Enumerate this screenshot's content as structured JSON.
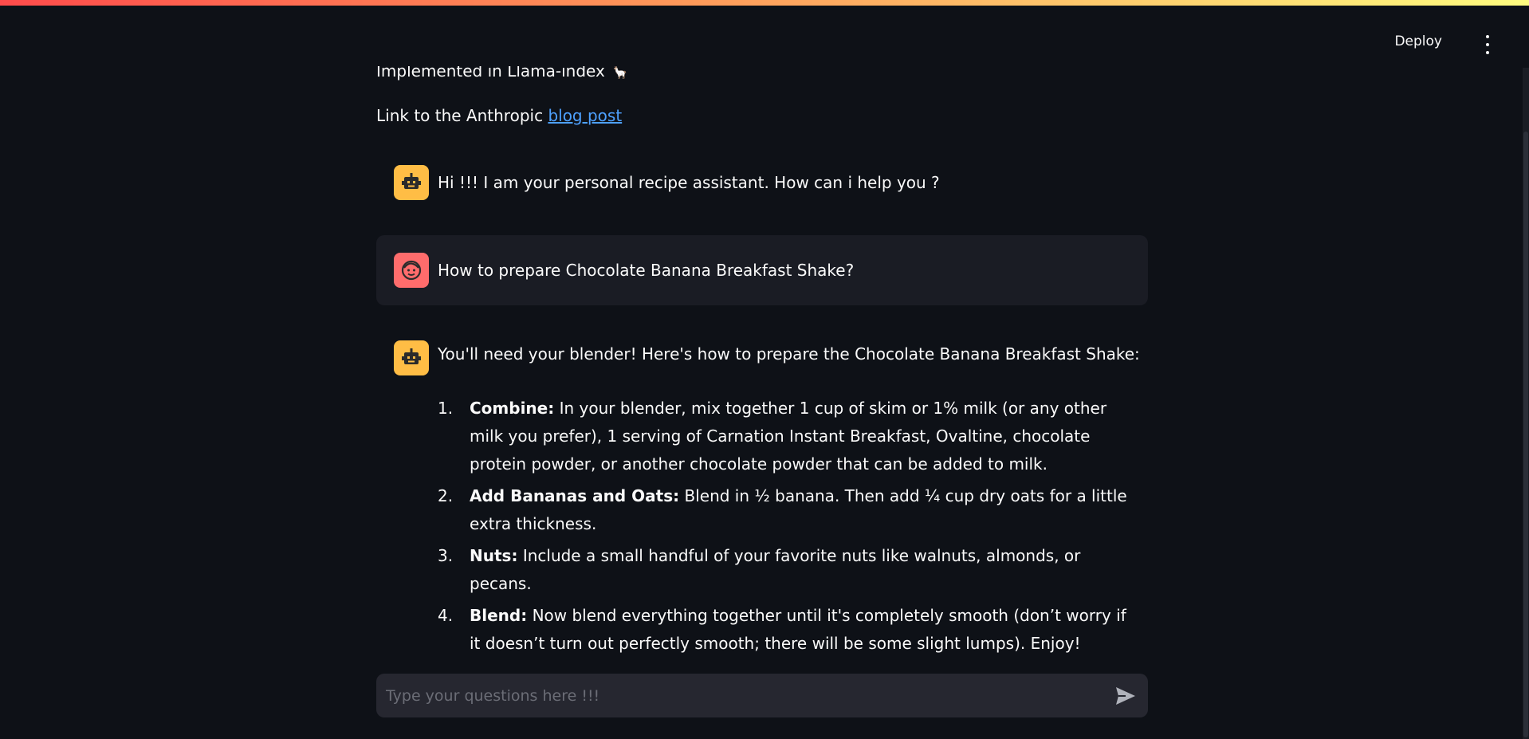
{
  "header": {
    "deploy_label": "Deploy",
    "menu_icon": "vertical-ellipsis-icon",
    "accent_gradient": [
      "#ff4b4b",
      "#fffd80"
    ]
  },
  "intro": {
    "partial_line": "Implemented in Llama-index",
    "partial_emoji": "llama-icon",
    "link_prefix": "Link to the Anthropic",
    "link_text": "blog post"
  },
  "messages": [
    {
      "role": "assistant",
      "avatar_icon": "robot-face-icon",
      "text": "Hi !!! I am your personal recipe assistant. How can i help you ?"
    },
    {
      "role": "user",
      "avatar_icon": "smiling-face-icon",
      "text": "How to prepare Chocolate Banana Breakfast Shake?"
    },
    {
      "role": "assistant",
      "avatar_icon": "robot-face-icon",
      "text": "You'll need your blender! Here's how to prepare the Chocolate Banana Breakfast Shake:",
      "steps": [
        {
          "num": "1.",
          "title": "Combine:",
          "body": "In your blender, mix together 1 cup of skim or 1% milk (or any other milk you prefer), 1 serving of Carnation Instant Breakfast, Ovaltine, chocolate protein powder, or another chocolate powder that can be added to milk."
        },
        {
          "num": "2.",
          "title": "Add Bananas and Oats:",
          "body": "Blend in ½ banana. Then add ¼ cup dry oats for a little extra thickness."
        },
        {
          "num": "3.",
          "title": "Nuts:",
          "body": "Include a small handful of your favorite nuts like walnuts, almonds, or pecans."
        },
        {
          "num": "4.",
          "title": "Blend:",
          "body": "Now blend everything together until it's completely smooth (don’t worry if it doesn’t turn out perfectly smooth; there will be some slight lumps). Enjoy!"
        }
      ]
    }
  ],
  "chat_input": {
    "placeholder": "Type your questions here !!!",
    "value": "",
    "send_icon": "send-arrow-icon"
  },
  "colors": {
    "background": "#0e1117",
    "user_bubble": "#1a1c24",
    "assistant_avatar": "#ffbd45",
    "user_avatar": "#ff6c6c",
    "link": "#4ea1ff",
    "input_bg": "#262730"
  }
}
